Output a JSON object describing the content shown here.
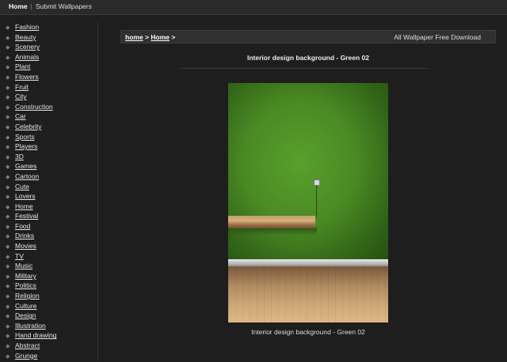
{
  "top_nav": {
    "home": "Home",
    "separator": "|",
    "submit": "Submit Wallpapers"
  },
  "sidebar": {
    "categories": [
      "Fashion",
      "Beauty",
      "Scenery",
      "Animals",
      "Plant",
      "Flowers",
      "Fruit",
      "City",
      "Construction",
      "Car",
      "Celebrity",
      "Sports",
      "Players",
      "3D",
      "Games",
      "Cartoon",
      "Cute",
      "Lovers",
      "Home",
      "Festival",
      "Food",
      "Drinks",
      "Movies",
      "TV",
      "Music",
      "Military",
      "Politics",
      "Religion",
      "Culture",
      "Design",
      "Illustration",
      "Hand drawing",
      "Abstract",
      "Grunge"
    ]
  },
  "breadcrumb": {
    "item1": "home",
    "sep1": ">",
    "item2": "Home",
    "sep2": ">",
    "right_text": "All Wallpaper Free Download"
  },
  "page": {
    "title": "Interior design background - Green 02",
    "caption": "Interior design background - Green 02"
  },
  "colors": {
    "background": "#1e1e1e",
    "wall_green": "#4a8a24",
    "floor_wood": "#cfa878"
  }
}
